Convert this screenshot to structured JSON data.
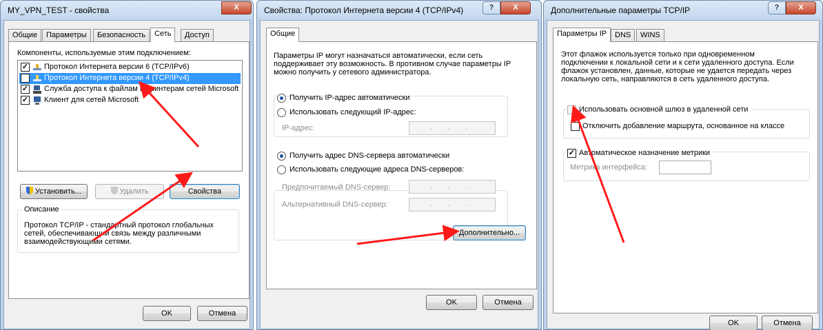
{
  "win1": {
    "title": "MY_VPN_TEST - свойства",
    "tabs": [
      "Общие",
      "Параметры",
      "Безопасность",
      "Сеть",
      "Доступ"
    ],
    "components_label": "Компоненты, используемые этим подключением:",
    "components": [
      {
        "label": "Протокол Интернета версии 6 (TCP/IPv6)",
        "checked": true,
        "icon": "network-protocol-icon"
      },
      {
        "label": "Протокол Интернета версии 4 (TCP/IPv4)",
        "checked": true,
        "icon": "network-protocol-icon"
      },
      {
        "label": "Служба доступа к файлам и принтерам сетей Microsoft",
        "checked": true,
        "icon": "file-printer-service-icon"
      },
      {
        "label": "Клиент для сетей Microsoft",
        "checked": true,
        "icon": "network-client-icon"
      }
    ],
    "install_btn": "Установить...",
    "remove_btn": "Удалить",
    "properties_btn": "Свойства",
    "description_title": "Описание",
    "description": "Протокол TCP/IP - стандартный протокол глобальных сетей, обеспечивающий связь между различными взаимодействующими сетями.",
    "ok": "OK",
    "cancel": "Отмена"
  },
  "win2": {
    "title": "Свойства: Протокол Интернета версии 4 (TCP/IPv4)",
    "tab": "Общие",
    "intro": "Параметры IP могут назначаться автоматически, если сеть поддерживает эту возможность. В противном случае параметры IP можно получить у сетевого администратора.",
    "auto_ip": "Получить IP-адрес автоматически",
    "manual_ip": "Использовать следующий IP-адрес:",
    "ip_label": "IP-адрес:",
    "auto_dns": "Получить адрес DNS-сервера автоматически",
    "manual_dns": "Использовать следующие адреса DNS-серверов:",
    "pref_dns": "Предпочитаемый DNS-сервер:",
    "alt_dns": "Альтернативный DNS-сервер:",
    "ip_mask": ". . .",
    "advanced_btn": "Дополнительно...",
    "ok": "OK",
    "cancel": "Отмена"
  },
  "win3": {
    "title": "Дополнительные параметры TCP/IP",
    "tabs": [
      "Параметры IP",
      "DNS",
      "WINS"
    ],
    "info": "Этот флажок используется только при одновременном подключении к локальной сети и к сети удаленного доступа. Если флажок установлен, данные, которые не удается передать через локальную сеть, направляются в сеть удаленного доступа.",
    "use_gateway": "Использовать основной шлюз в удаленной сети",
    "disable_route": "Отключить добавление маршрута, основанное на классе",
    "auto_metric": "Автоматическое назначение метрики",
    "metric_label": "Метрика интерфейса:",
    "ok": "OK",
    "cancel": "Отмена"
  },
  "titlebar": {
    "help": "?",
    "close": "X"
  },
  "colors": {
    "annotation_arrow": "#ff1a1a",
    "selection": "#3399ff",
    "titlebar": "#c3d7ee"
  }
}
